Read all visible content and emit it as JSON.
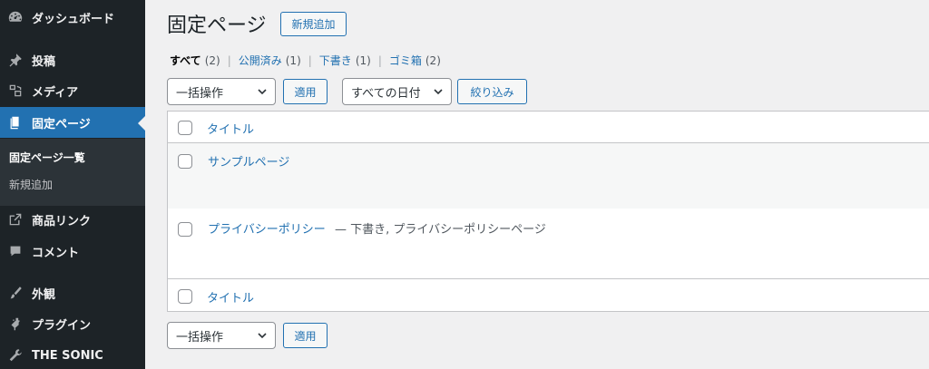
{
  "sidebar": {
    "items": [
      {
        "label": "ダッシュボード",
        "icon": "dashboard-icon"
      },
      {
        "label": "投稿",
        "icon": "pin-icon"
      },
      {
        "label": "メディア",
        "icon": "media-icon"
      },
      {
        "label": "固定ページ",
        "icon": "page-icon",
        "current": true
      },
      {
        "label": "商品リンク",
        "icon": "external-link-icon"
      },
      {
        "label": "コメント",
        "icon": "comment-icon"
      },
      {
        "label": "外観",
        "icon": "brush-icon"
      },
      {
        "label": "プラグイン",
        "icon": "plugin-icon"
      },
      {
        "label": "THE SONIC",
        "icon": "wrench-icon"
      }
    ],
    "submenu": [
      {
        "label": "固定ページ一覧",
        "active": true
      },
      {
        "label": "新規追加"
      }
    ]
  },
  "header": {
    "title": "固定ページ",
    "add_new_label": "新規追加"
  },
  "filters": {
    "all_label": "すべて",
    "all_count": "(2)",
    "published_label": "公開済み",
    "published_count": "(1)",
    "draft_label": "下書き",
    "draft_count": "(1)",
    "trash_label": "ゴミ箱",
    "trash_count": "(2)",
    "separator": "|"
  },
  "tablenav_top": {
    "bulk_action": "一括操作",
    "apply": "適用",
    "date_filter": "すべての日付",
    "filter_button": "絞り込み"
  },
  "table": {
    "column_title": "タイトル",
    "rows": [
      {
        "title": "サンプルページ",
        "state": ""
      },
      {
        "title": "プライバシーポリシー",
        "state": " — 下書き, プライバシーポリシーページ"
      }
    ]
  },
  "tablenav_bottom": {
    "bulk_action": "一括操作",
    "apply": "適用"
  },
  "colors": {
    "sidebar_bg": "#1d2327",
    "accent": "#2271b1",
    "page_bg": "#f0f0f1"
  }
}
